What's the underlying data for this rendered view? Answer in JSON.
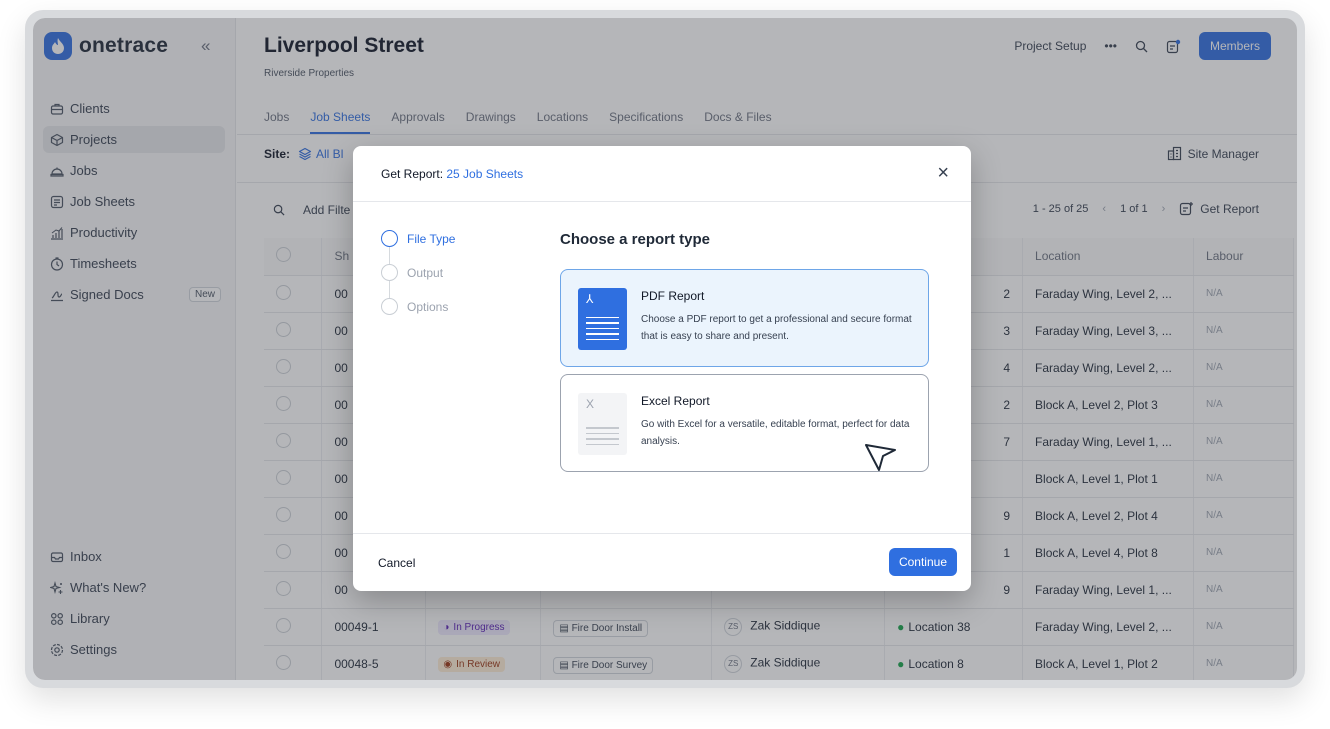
{
  "brand": {
    "name": "onetrace",
    "color": "#2f6fe0"
  },
  "sidebar": {
    "items": [
      {
        "label": "Clients",
        "icon": "clients-icon"
      },
      {
        "label": "Projects",
        "icon": "projects-icon"
      },
      {
        "label": "Jobs",
        "icon": "jobs-icon"
      },
      {
        "label": "Job Sheets",
        "icon": "job-sheets-icon"
      },
      {
        "label": "Productivity",
        "icon": "productivity-icon"
      },
      {
        "label": "Timesheets",
        "icon": "timesheets-icon"
      },
      {
        "label": "Signed Docs",
        "icon": "signed-docs-icon",
        "badge": "New"
      }
    ],
    "bottom": [
      {
        "label": "Inbox",
        "icon": "inbox-icon"
      },
      {
        "label": "What's New?",
        "icon": "sparkle-icon"
      },
      {
        "label": "Library",
        "icon": "library-icon"
      },
      {
        "label": "Settings",
        "icon": "settings-icon"
      }
    ]
  },
  "header": {
    "title": "Liverpool Street",
    "subtitle": "Riverside Properties",
    "project_setup": "Project Setup",
    "members": "Members"
  },
  "tabs": [
    "Jobs",
    "Job Sheets",
    "Approvals",
    "Drawings",
    "Locations",
    "Specifications",
    "Docs & Files"
  ],
  "site": {
    "label": "Site:",
    "value": "All Bl",
    "manager": "Site Manager"
  },
  "filter": {
    "add_filter": "Add Filte",
    "range": "1 - 25 of 25",
    "page": "1 of 1",
    "get_report": "Get Report"
  },
  "table": {
    "columns": [
      "Sh",
      "Location",
      "Labour"
    ],
    "rows": [
      {
        "id": "00",
        "num": "2",
        "location": "Faraday Wing, Level 2, ...",
        "labour": "N/A"
      },
      {
        "id": "00",
        "num": "3",
        "location": "Faraday Wing, Level 3, ...",
        "labour": "N/A"
      },
      {
        "id": "00",
        "num": "4",
        "location": "Faraday Wing, Level 2, ...",
        "labour": "N/A"
      },
      {
        "id": "00",
        "num": "2",
        "location": "Block A, Level 2, Plot 3",
        "labour": "N/A"
      },
      {
        "id": "00",
        "num": "7",
        "location": "Faraday Wing, Level 1, ...",
        "labour": "N/A"
      },
      {
        "id": "00",
        "num": "",
        "location": "Block A, Level 1, Plot 1",
        "labour": "N/A"
      },
      {
        "id": "00",
        "num": "9",
        "location": "Block A, Level 2, Plot 4",
        "labour": "N/A"
      },
      {
        "id": "00",
        "num": "1",
        "location": "Block A, Level 4, Plot 8",
        "labour": "N/A"
      },
      {
        "id": "00",
        "num": "9",
        "location": "Faraday Wing, Level 1, ...",
        "labour": "N/A"
      },
      {
        "id": "00049-1",
        "status": "In Progress",
        "type": "Fire Door Install",
        "initials": "ZS",
        "assignee": "Zak Siddique",
        "site_location": "Location 38",
        "location": "Faraday Wing, Level 2, ...",
        "labour": "N/A"
      },
      {
        "id": "00048-5",
        "status": "In Review",
        "type": "Fire Door Survey",
        "initials": "ZS",
        "assignee": "Zak Siddique",
        "site_location": "Location 8",
        "location": "Block A, Level 1, Plot 2",
        "labour": "N/A"
      }
    ]
  },
  "modal": {
    "title_prefix": "Get Report:",
    "title_count": "25 Job Sheets",
    "steps": [
      "File Type",
      "Output",
      "Options"
    ],
    "heading": "Choose a report type",
    "options": [
      {
        "title": "PDF Report",
        "desc": "Choose a PDF report to get a professional and secure format that is easy to share and present.",
        "icon": "pdf-file-icon"
      },
      {
        "title": "Excel Report",
        "desc": "Go with Excel for a versatile, editable format, perfect for data analysis.",
        "icon": "excel-file-icon"
      }
    ],
    "cancel": "Cancel",
    "continue": "Continue"
  }
}
